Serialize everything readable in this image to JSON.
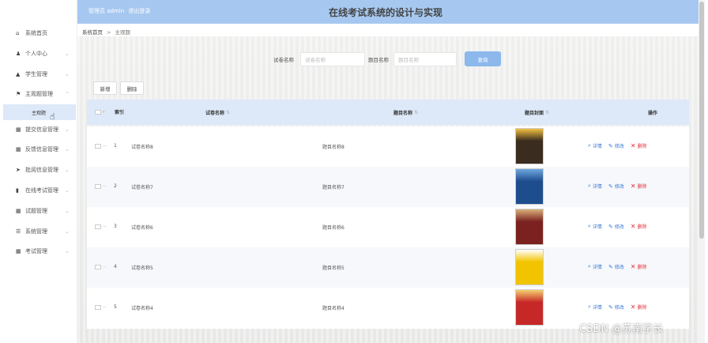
{
  "header": {
    "admin_role": "管理员 admin",
    "logout": "退出登录",
    "title": "在线考试系统的设计与实现"
  },
  "sidebar": {
    "items": [
      {
        "label": "系统首页",
        "icon": "home-icon"
      },
      {
        "label": "个人中心",
        "icon": "user-icon"
      },
      {
        "label": "学生管理",
        "icon": "student-icon"
      },
      {
        "label": "主观题管理",
        "icon": "flag-icon"
      },
      {
        "label": "提交信息管理",
        "icon": "grid-icon"
      },
      {
        "label": "反馈信息管理",
        "icon": "grid-icon"
      },
      {
        "label": "批阅信息管理",
        "icon": "send-icon"
      },
      {
        "label": "在线考试管理",
        "icon": "bar-chart-icon"
      },
      {
        "label": "试题管理",
        "icon": "grid-icon"
      },
      {
        "label": "系统管理",
        "icon": "menu-icon"
      },
      {
        "label": "考试管理",
        "icon": "grid-icon"
      }
    ],
    "active_sub": "主观题"
  },
  "breadcrumb": {
    "home": "系统首页",
    "sep": ">",
    "current": "主观题"
  },
  "search": {
    "paper_label": "试卷名称",
    "paper_placeholder": "试卷名称",
    "topic_label": "题目名称",
    "topic_placeholder": "题目名称",
    "button": "查询"
  },
  "actions": {
    "add": "新增",
    "delete": "删除"
  },
  "table": {
    "headers": {
      "index": "索引",
      "paper": "试卷名称",
      "topic": "题目名称",
      "cover": "题目封面",
      "ops": "操作"
    },
    "op_labels": {
      "view": "详情",
      "edit": "修改",
      "delete": "删除"
    },
    "rows": [
      {
        "index": "1",
        "paper": "试卷名称8",
        "topic": "题目名称8",
        "cover_color": "#3a2c1e",
        "cover_accent": "#f0c040"
      },
      {
        "index": "2",
        "paper": "试卷名称7",
        "topic": "题目名称7",
        "cover_color": "#1e4d8e",
        "cover_accent": "#6ea8e0"
      },
      {
        "index": "3",
        "paper": "试卷名称6",
        "topic": "题目名称6",
        "cover_color": "#7b2220",
        "cover_accent": "#d9b07a"
      },
      {
        "index": "4",
        "paper": "试卷名称5",
        "topic": "题目名称5",
        "cover_color": "#f2c400",
        "cover_accent": "#ffffff"
      },
      {
        "index": "5",
        "paper": "试卷名称4",
        "topic": "题目名称4",
        "cover_color": "#c62828",
        "cover_accent": "#f4d06f"
      }
    ]
  },
  "watermark": "CSDN @苏南学长",
  "colors": {
    "header_bg": "#a6c8f0",
    "accent": "#3a7bd5",
    "danger": "#e0333a",
    "active_bg": "#dde9f8"
  }
}
